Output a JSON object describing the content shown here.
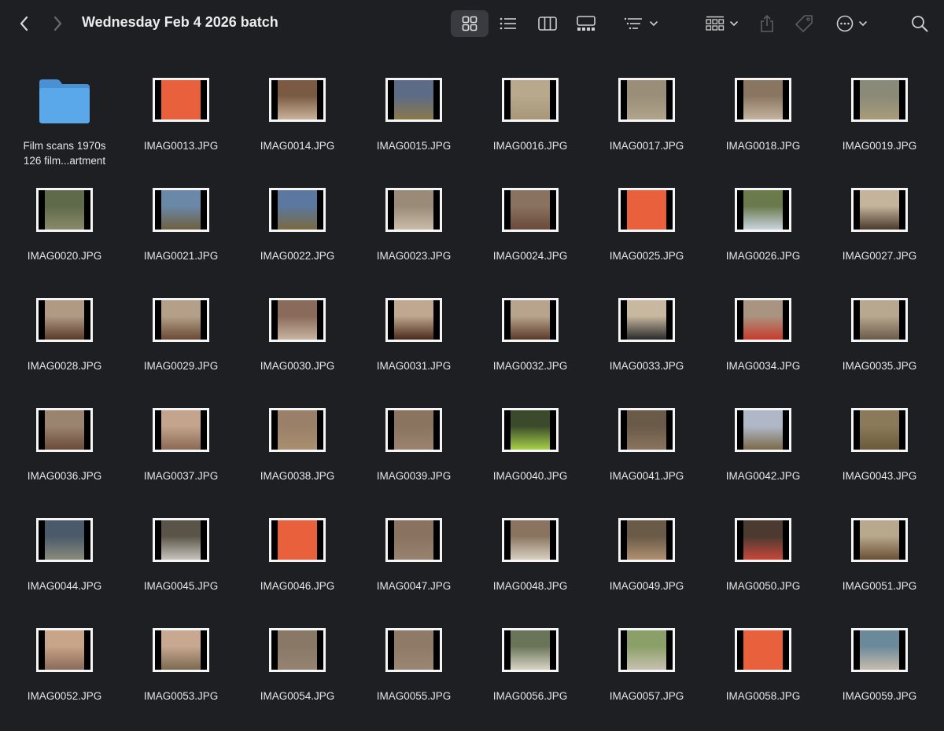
{
  "window": {
    "title": "Wednesday Feb 4 2026 batch"
  },
  "toolbar": {
    "icons": [
      "back-icon",
      "forward-icon",
      "icon-view-icon",
      "list-view-icon",
      "column-view-icon",
      "gallery-view-icon",
      "sort-icon",
      "group-icon",
      "share-icon",
      "tag-icon",
      "more-icon",
      "search-icon"
    ],
    "active_view": "icon-view"
  },
  "folder": {
    "line1": "Film scans 1970s",
    "line2": "126 film...artment",
    "color": "#5aa8ea"
  },
  "files": [
    {
      "name": "IMAG0013.JPG",
      "colors": [
        "#e8603c",
        "#e8603c"
      ]
    },
    {
      "name": "IMAG0014.JPG",
      "colors": [
        "#7a5a42",
        "#c9b49a"
      ]
    },
    {
      "name": "IMAG0015.JPG",
      "colors": [
        "#5c6b86",
        "#8a7a4a"
      ]
    },
    {
      "name": "IMAG0016.JPG",
      "colors": [
        "#b8a88c",
        "#a89878"
      ]
    },
    {
      "name": "IMAG0017.JPG",
      "colors": [
        "#9a8e78",
        "#b0a48c"
      ]
    },
    {
      "name": "IMAG0018.JPG",
      "colors": [
        "#8a7660",
        "#c4b4a0"
      ]
    },
    {
      "name": "IMAG0019.JPG",
      "colors": [
        "#8a8a78",
        "#a89c7a"
      ]
    },
    {
      "name": "IMAG0020.JPG",
      "colors": [
        "#5e6a4a",
        "#8a8a6a"
      ]
    },
    {
      "name": "IMAG0021.JPG",
      "colors": [
        "#6a88a8",
        "#6e6040"
      ]
    },
    {
      "name": "IMAG0022.JPG",
      "colors": [
        "#5a78a0",
        "#7a6a40"
      ]
    },
    {
      "name": "IMAG0023.JPG",
      "colors": [
        "#9a8a78",
        "#c8bca8"
      ]
    },
    {
      "name": "IMAG0024.JPG",
      "colors": [
        "#8a7260",
        "#6a4a3a"
      ]
    },
    {
      "name": "IMAG0025.JPG",
      "colors": [
        "#e8603c",
        "#e8603c"
      ]
    },
    {
      "name": "IMAG0026.JPG",
      "colors": [
        "#6a7a4a",
        "#c8d4e0"
      ]
    },
    {
      "name": "IMAG0027.JPG",
      "colors": [
        "#c4b49c",
        "#4a3a2a"
      ]
    },
    {
      "name": "IMAG0028.JPG",
      "colors": [
        "#b09a84",
        "#5a3a2a"
      ]
    },
    {
      "name": "IMAG0029.JPG",
      "colors": [
        "#b4a088",
        "#6a4a34"
      ]
    },
    {
      "name": "IMAG0030.JPG",
      "colors": [
        "#8a6a5a",
        "#c8b4a0"
      ]
    },
    {
      "name": "IMAG0031.JPG",
      "colors": [
        "#c0a890",
        "#4a2a1a"
      ]
    },
    {
      "name": "IMAG0032.JPG",
      "colors": [
        "#b8a48c",
        "#5a3a2a"
      ]
    },
    {
      "name": "IMAG0033.JPG",
      "colors": [
        "#c8b8a0",
        "#2a2a2a"
      ]
    },
    {
      "name": "IMAG0034.JPG",
      "colors": [
        "#a89480",
        "#c83a2a"
      ]
    },
    {
      "name": "IMAG0035.JPG",
      "colors": [
        "#b8a890",
        "#6a5a4a"
      ]
    },
    {
      "name": "IMAG0036.JPG",
      "colors": [
        "#9a8470",
        "#6a4a3a"
      ]
    },
    {
      "name": "IMAG0037.JPG",
      "colors": [
        "#c4a48c",
        "#8a6a54"
      ]
    },
    {
      "name": "IMAG0038.JPG",
      "colors": [
        "#9a8068",
        "#a89070"
      ]
    },
    {
      "name": "IMAG0039.JPG",
      "colors": [
        "#8a7460",
        "#9a8470"
      ]
    },
    {
      "name": "IMAG0040.JPG",
      "colors": [
        "#3a4a2a",
        "#a8d048"
      ]
    },
    {
      "name": "IMAG0041.JPG",
      "colors": [
        "#6a5a48",
        "#8a7460"
      ]
    },
    {
      "name": "IMAG0042.JPG",
      "colors": [
        "#b0b8c8",
        "#7a6a4a"
      ]
    },
    {
      "name": "IMAG0043.JPG",
      "colors": [
        "#8a7a5a",
        "#6a5a3a"
      ]
    },
    {
      "name": "IMAG0044.JPG",
      "colors": [
        "#4a5a6a",
        "#8a8a7a"
      ]
    },
    {
      "name": "IMAG0045.JPG",
      "colors": [
        "#5a5448",
        "#c8c4bc"
      ]
    },
    {
      "name": "IMAG0046.JPG",
      "colors": [
        "#e8603c",
        "#e8603c"
      ]
    },
    {
      "name": "IMAG0047.JPG",
      "colors": [
        "#8a7260",
        "#9a8270"
      ]
    },
    {
      "name": "IMAG0048.JPG",
      "colors": [
        "#8a7460",
        "#d8d0c0"
      ]
    },
    {
      "name": "IMAG0049.JPG",
      "colors": [
        "#6a5a48",
        "#b09070"
      ]
    },
    {
      "name": "IMAG0050.JPG",
      "colors": [
        "#4a3a30",
        "#c8483a"
      ]
    },
    {
      "name": "IMAG0051.JPG",
      "colors": [
        "#b8a88c",
        "#6a5034"
      ]
    },
    {
      "name": "IMAG0052.JPG",
      "colors": [
        "#c8a488",
        "#8a6a5a"
      ]
    },
    {
      "name": "IMAG0053.JPG",
      "colors": [
        "#c8a890",
        "#7a6a50"
      ]
    },
    {
      "name": "IMAG0054.JPG",
      "colors": [
        "#8a7866",
        "#968472"
      ]
    },
    {
      "name": "IMAG0055.JPG",
      "colors": [
        "#8e7a66",
        "#9a8672"
      ]
    },
    {
      "name": "IMAG0056.JPG",
      "colors": [
        "#6a7458",
        "#d8d4c4"
      ]
    },
    {
      "name": "IMAG0057.JPG",
      "colors": [
        "#8aa068",
        "#c8c0b0"
      ]
    },
    {
      "name": "IMAG0058.JPG",
      "colors": [
        "#e8603c",
        "#e8603c"
      ]
    },
    {
      "name": "IMAG0059.JPG",
      "colors": [
        "#6a8a9a",
        "#c8bcac"
      ]
    }
  ]
}
